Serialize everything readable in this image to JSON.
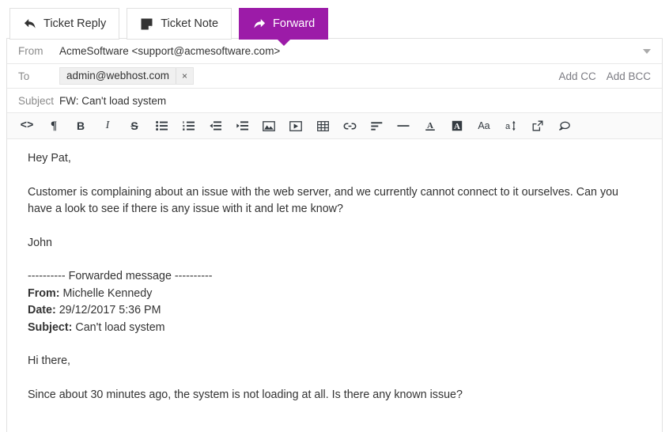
{
  "actions": [
    {
      "label": "Ticket Reply",
      "icon": "reply-arrow-icon",
      "active": false
    },
    {
      "label": "Ticket Note",
      "icon": "note-icon",
      "active": false
    },
    {
      "label": "Forward",
      "icon": "forward-arrow-icon",
      "active": true
    }
  ],
  "accent_color": "#9c1ba8",
  "fields": {
    "from_label": "From",
    "from_value": "AcmeSoftware <support@acmesoftware.com>",
    "to_label": "To",
    "to_recipient": "admin@webhost.com",
    "to_remove": "×",
    "add_cc": "Add CC",
    "add_bcc": "Add BCC",
    "subject_label": "Subject",
    "subject_value": "FW: Can't load system"
  },
  "toolbar": [
    {
      "name": "source-code-icon",
      "title": "Source code"
    },
    {
      "name": "paragraph-icon",
      "title": "Paragraph"
    },
    {
      "name": "bold-icon",
      "title": "Bold"
    },
    {
      "name": "italic-icon",
      "title": "Italic"
    },
    {
      "name": "strikethrough-icon",
      "title": "Strikethrough"
    },
    {
      "name": "unordered-list-icon",
      "title": "Bulleted list"
    },
    {
      "name": "ordered-list-icon",
      "title": "Numbered list"
    },
    {
      "name": "outdent-icon",
      "title": "Decrease indent"
    },
    {
      "name": "indent-icon",
      "title": "Increase indent"
    },
    {
      "name": "image-icon",
      "title": "Insert image"
    },
    {
      "name": "video-icon",
      "title": "Insert video"
    },
    {
      "name": "table-icon",
      "title": "Insert table"
    },
    {
      "name": "link-icon",
      "title": "Insert link"
    },
    {
      "name": "align-icon",
      "title": "Alignment"
    },
    {
      "name": "horizontal-rule-icon",
      "title": "Horizontal line"
    },
    {
      "name": "text-color-icon",
      "title": "Text color"
    },
    {
      "name": "background-color-icon",
      "title": "Background color"
    },
    {
      "name": "font-family-icon",
      "title": "Font family"
    },
    {
      "name": "font-size-icon",
      "title": "Font size"
    },
    {
      "name": "fullscreen-icon",
      "title": "Fullscreen"
    },
    {
      "name": "comment-icon",
      "title": "Comment"
    }
  ],
  "body": {
    "greeting": "Hey Pat,",
    "paragraph": "Customer is complaining about an issue with the web server, and we currently cannot connect to it ourselves. Can you have a look to see if there is any issue with it and let me know?",
    "signature": "John",
    "forwarded_divider": "---------- Forwarded message ----------",
    "forwarded_from_label": "From:",
    "forwarded_from_value": "Michelle Kennedy",
    "forwarded_date_label": "Date:",
    "forwarded_date_value": "29/12/2017 5:36 PM",
    "forwarded_subject_label": "Subject:",
    "forwarded_subject_value": "Can't load system",
    "quoted_greeting": "Hi there,",
    "quoted_paragraph": "Since about 30 minutes ago, the system is not loading at all. Is there any known issue?"
  }
}
